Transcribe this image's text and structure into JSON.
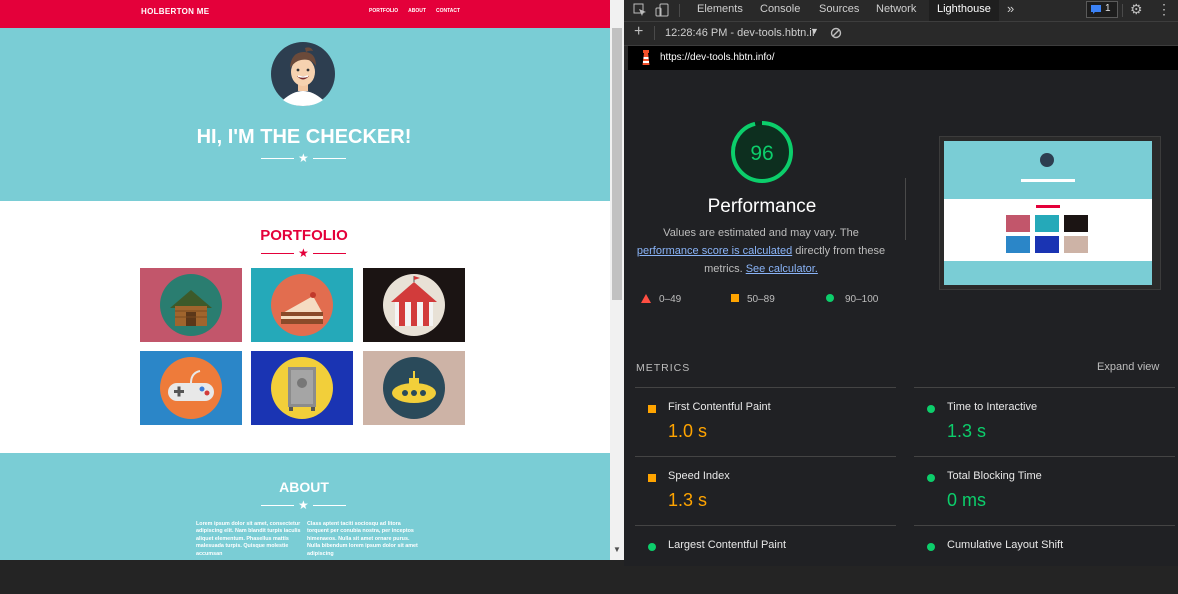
{
  "site": {
    "brand": "HOLBERTON ME",
    "nav": [
      "PORTFOLIO",
      "ABOUT",
      "CONTACT"
    ],
    "hero_title": "HI, I'M THE CHECKER!",
    "portfolio_title": "PORTFOLIO",
    "portfolio_tiles": [
      {
        "name": "cabin",
        "bg": "#c2566b"
      },
      {
        "name": "cake",
        "bg": "#25a9b9"
      },
      {
        "name": "circus-tent",
        "bg": "#1b1413"
      },
      {
        "name": "game-controller",
        "bg": "#2b86c8"
      },
      {
        "name": "safe",
        "bg": "#1a34b3"
      },
      {
        "name": "submarine",
        "bg": "#cdb3a6"
      }
    ],
    "about_title": "ABOUT",
    "about_col1": "Lorem ipsum dolor sit amet, consectetur adipiscing elit. Nam blandit turpis iaculis aliquet elementum. Phasellus mattis malesuada turpis. Quisque molestie accumsan",
    "about_col2": "Class aptent taciti sociosqu ad litora torquent per conubia nostra, per inceptos himenaeos. Nulla sit amet ornare purus. Nulla bibendum lorem ipsum dolor sit amet adipiscing"
  },
  "devtools": {
    "tabs": [
      "Elements",
      "Console",
      "Sources",
      "Network",
      "Lighthouse"
    ],
    "active_tab": "Lighthouse",
    "issues_count": "1",
    "report_selector": "12:28:46 PM - dev-tools.hbtn.iı",
    "url": "https://dev-tools.hbtn.info/",
    "score": 96,
    "score_label": "Performance",
    "desc_pre": "Values are estimated and may vary. The ",
    "desc_link1": "performance score is calculated",
    "desc_mid": " directly from these metrics. ",
    "desc_link2": "See calculator.",
    "legend": [
      {
        "range": "0–49",
        "color": "#ff4e42",
        "shape": "triangle"
      },
      {
        "range": "50–89",
        "color": "#ffa400",
        "shape": "square"
      },
      {
        "range": "90–100",
        "color": "#0cce6b",
        "shape": "circle"
      }
    ],
    "metrics_heading": "METRICS",
    "expand_view": "Expand view",
    "metrics": [
      {
        "label": "First Contentful Paint",
        "value": "1.0 s",
        "status": "average"
      },
      {
        "label": "Time to Interactive",
        "value": "1.3 s",
        "status": "pass"
      },
      {
        "label": "Speed Index",
        "value": "1.3 s",
        "status": "average"
      },
      {
        "label": "Total Blocking Time",
        "value": "0 ms",
        "status": "pass"
      },
      {
        "label": "Largest Contentful Paint",
        "value": "",
        "status": "pass"
      },
      {
        "label": "Cumulative Layout Shift",
        "value": "",
        "status": "pass"
      }
    ],
    "colors": {
      "pass": "#0cce6b",
      "average": "#ffa400",
      "fail": "#ff4e42"
    }
  }
}
